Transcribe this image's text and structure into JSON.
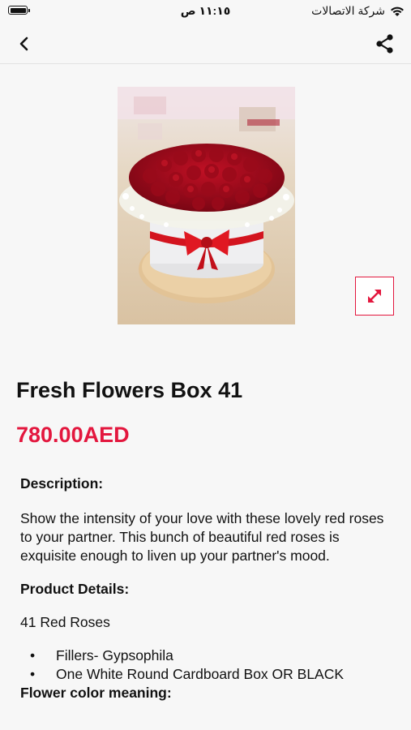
{
  "status_bar": {
    "time": "١١:١٥ ص",
    "carrier": "شركة الاتصالات"
  },
  "nav": {
    "back_icon": "chevron-left-icon",
    "share_icon": "share-icon"
  },
  "product": {
    "title": "Fresh Flowers Box 41",
    "price": "780.00AED",
    "image_icon": "red-roses-box-image",
    "expand_icon": "expand-arrows-icon"
  },
  "description": {
    "heading": "Description:",
    "text": "Show the intensity of your love with these lovely red roses to your partner. This bunch of beautiful red roses is exquisite enough to liven up your partner's mood."
  },
  "details": {
    "heading": "Product Details:",
    "roses": "41 Red Roses",
    "items": [
      "Fillers- Gypsophila",
      "One White Round Cardboard Box OR BLACK"
    ]
  },
  "color_meaning": {
    "heading": "Flower color meaning:"
  },
  "colors": {
    "accent": "#e3173e",
    "background": "#f7f7f7",
    "text": "#111111"
  }
}
